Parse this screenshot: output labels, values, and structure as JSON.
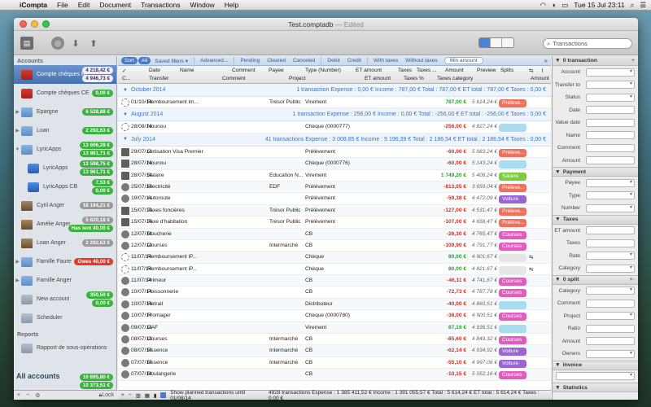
{
  "menubar": {
    "app": "iCompta",
    "items": [
      "File",
      "Edit",
      "Document",
      "Transactions",
      "Window",
      "Help"
    ],
    "clock": "Tue 15 Jul  23:11"
  },
  "window": {
    "title": "Test.comptadb",
    "edited": " — Edited"
  },
  "toolbar": {
    "search_placeholder": "Transactions"
  },
  "sidebar": {
    "header": "Accounts",
    "accounts": [
      {
        "name": "Compte chèques BP",
        "icon": "bank",
        "balances": [
          "4 218,42 €",
          "4 946,73 €"
        ],
        "colors": [
          "white",
          "white"
        ],
        "selected": true
      },
      {
        "name": "Compte chèques CE",
        "icon": "bank",
        "balances": [
          "0,00 €"
        ],
        "colors": [
          "green"
        ]
      },
      {
        "name": "Epargne",
        "icon": "folder",
        "disclosure": "▶",
        "balances": [
          "6 528,88 €"
        ],
        "colors": [
          "green"
        ]
      },
      {
        "name": "Loan",
        "icon": "folder",
        "disclosure": "▶",
        "balances": [
          "2 292,63 €"
        ],
        "colors": [
          "green"
        ]
      },
      {
        "name": "LyricApps",
        "icon": "folder",
        "disclosure": "▼",
        "balances": [
          "13 606,28 €",
          "13 961,71 €"
        ],
        "colors": [
          "green",
          "green"
        ]
      },
      {
        "name": "LyricApps",
        "icon": "app",
        "indent": true,
        "balances": [
          "13 598,75 €",
          "13 961,71 €"
        ],
        "colors": [
          "green",
          "green"
        ]
      },
      {
        "name": "LyricApps CB",
        "icon": "app",
        "indent": true,
        "balances": [
          "7,53 €",
          "0,00 €"
        ],
        "colors": [
          "green",
          "green"
        ]
      },
      {
        "name": "Cyril Anger",
        "icon": "face",
        "balances": [
          "18 194,21 €"
        ],
        "colors": [
          "gray"
        ]
      },
      {
        "name": "Amélie Anger",
        "icon": "face",
        "balances": [
          "5 820,18 €",
          "Has lent 40,00 €"
        ],
        "colors": [
          "gray",
          "green"
        ]
      },
      {
        "name": "Loan Anger",
        "icon": "face",
        "balances": [
          "2 292,63 €"
        ],
        "colors": [
          "gray"
        ]
      },
      {
        "name": "Famille Faure",
        "icon": "folder",
        "disclosure": "▶",
        "balances": [
          "Owes 40,00 €"
        ],
        "colors": [
          "red"
        ]
      },
      {
        "name": "Famille Anger",
        "icon": "folder",
        "disclosure": "▶",
        "balances": [],
        "colors": []
      },
      {
        "name": "New account",
        "icon": "plain",
        "balances": [
          "350,50 €",
          "0,00 €"
        ],
        "colors": [
          "green",
          "green"
        ]
      },
      {
        "name": "Scheduler",
        "icon": "plain",
        "balances": [],
        "colors": []
      }
    ],
    "reports_header": "Reports",
    "report_item": "Rapport de sous-opérations",
    "all_accounts": "All accounts",
    "all_balances": [
      "10 895,80 €",
      "10 373,61 €"
    ],
    "footer": {
      "plus": "+",
      "minus": "−",
      "gear": "⚙",
      "lock": "Lock"
    }
  },
  "filters": [
    "Sort",
    "All",
    "Saved filters ▾",
    "Advanced...",
    "Pending",
    "Cleared",
    "Canceled",
    "Debit",
    "Credit",
    "With taxes",
    "Without taxes"
  ],
  "min_amount_placeholder": "Min amount",
  "columns": {
    "row1": [
      "✓",
      "Date",
      "Name",
      "Comment",
      "Payee",
      "Type (Number)",
      "ET amount",
      "Taxes",
      "Taxes ...",
      "Amount",
      "Preview",
      "Splits"
    ],
    "row2": [
      "C...",
      "Transfer",
      "Comment",
      "Project",
      "ET amount",
      "Taxes %",
      "Taxes category",
      "Amount"
    ]
  },
  "groups": [
    {
      "month": "October 2014",
      "summary": "1 transaction   Expense : 0,00 €   Income : 787,00 €   Total : 787,00 €   ET total : 787,00 €   Taxes : 0,00 €",
      "rows": [
        {
          "s": "pending",
          "d": "01/10/14",
          "n": "Remboursement im...",
          "p": "Trésor Public",
          "t": "Virement",
          "a": "787,00 €",
          "ac": "pos",
          "b": "5 614,24 €",
          "c": "Prélève...",
          "cc": "c-prel"
        }
      ]
    },
    {
      "month": "August 2014",
      "summary": "1 transaction   Expense : 256,00 €   Income : 0,00 €   Total : -256,00 €   ET total : -256,00 €   Taxes : 0,00 €",
      "rows": [
        {
          "s": "pending",
          "d": "28/08/14",
          "n": "Nounou",
          "p": "",
          "t": "Chèque (0000777)",
          "a": "-256,00 €",
          "ac": "neg",
          "b": "4 827,24 €",
          "c": "",
          "cc": "c-light"
        }
      ]
    },
    {
      "month": "July 2014",
      "summary": "41 transactions   Expense : 3 008,85 €   Income : 5 196,39 €   Total : 2 186,54 €   ET total : 2 186,54 €   Taxes : 0,00 €",
      "rows": [
        {
          "s": "cal",
          "d": "29/07/14",
          "n": "Cotisation Visa Premier",
          "p": "",
          "t": "Prélèvement",
          "a": "-60,00 €",
          "ac": "neg",
          "b": "5 083,24 €",
          "c": "Prélève...",
          "cc": "c-prel"
        },
        {
          "s": "cal",
          "d": "28/07/14",
          "n": "Nounou",
          "p": "",
          "t": "Chèque (0000776)",
          "a": "-60,00 €",
          "ac": "neg",
          "b": "5 143,24 €",
          "c": "",
          "cc": "c-light"
        },
        {
          "s": "cal",
          "d": "28/07/14",
          "n": "Salaire",
          "p": "Education N...",
          "t": "Virement",
          "a": "1 749,20 €",
          "ac": "pos",
          "b": "5 408,24 €",
          "c": "Salaire",
          "cc": "c-sal"
        },
        {
          "s": "check",
          "d": "25/07/14",
          "n": "Electricité",
          "p": "EDF",
          "t": "Prélèvement",
          "a": "-813,05 €",
          "ac": "neg",
          "b": "3 659,04 €",
          "c": "Prélève...",
          "cc": "c-prel"
        },
        {
          "s": "check",
          "d": "19/07/14",
          "n": "Autoroute",
          "p": "",
          "t": "Prélèvement",
          "a": "-59,38 €",
          "ac": "neg",
          "b": "4 472,09 €",
          "c": "Voiture",
          "cc": "c-voit"
        },
        {
          "s": "cal",
          "d": "15/07/14",
          "n": "Taxes foncières",
          "p": "Trésor Public",
          "t": "Prélèvement",
          "a": "-127,00 €",
          "ac": "neg",
          "b": "4 531,47 €",
          "c": "Prélève...",
          "cc": "c-prel"
        },
        {
          "s": "cal",
          "d": "15/07/14",
          "n": "Taxe d'habitation",
          "p": "Trésor Public",
          "t": "Prélèvement",
          "a": "-107,00 €",
          "ac": "neg",
          "b": "4 658,47 €",
          "c": "Prélève...",
          "cc": "c-prel"
        },
        {
          "s": "check",
          "d": "12/07/14",
          "n": "Boucherie",
          "p": "",
          "t": "CB",
          "a": "-26,30 €",
          "ac": "neg",
          "b": "4 765,47 €",
          "c": "Courses",
          "cc": "c-cours"
        },
        {
          "s": "check",
          "d": "12/07/14",
          "n": "Courses",
          "p": "Intermarché",
          "t": "CB",
          "a": "-109,90 €",
          "ac": "neg",
          "b": "4 791,77 €",
          "c": "Courses",
          "cc": "c-cours"
        },
        {
          "s": "pending",
          "d": "11/07/14",
          "n": "Remboursement iP...",
          "p": "",
          "t": "Chèque",
          "a": "80,00 €",
          "ac": "pos",
          "b": "4 901,67 €",
          "c": "",
          "cc": "c-grey",
          "split": true
        },
        {
          "s": "pending",
          "d": "11/07/14",
          "n": "Remboursement iP...",
          "p": "",
          "t": "Chèque",
          "a": "80,00 €",
          "ac": "pos",
          "b": "4 821,67 €",
          "c": "",
          "cc": "c-grey",
          "split": true
        },
        {
          "s": "check",
          "d": "11/07/14",
          "n": "Primeur",
          "p": "",
          "t": "CB",
          "a": "-46,11 €",
          "ac": "neg",
          "b": "4 741,67 €",
          "c": "Courses",
          "cc": "c-cours"
        },
        {
          "s": "check",
          "d": "10/07/14",
          "n": "Poissonnerie",
          "p": "",
          "t": "CB",
          "a": "-72,73 €",
          "ac": "neg",
          "b": "4 787,78 €",
          "c": "Courses",
          "cc": "c-cours"
        },
        {
          "s": "check",
          "d": "10/07/14",
          "n": "Retrait",
          "p": "",
          "t": "Distributeur",
          "a": "-40,00 €",
          "ac": "neg",
          "b": "4 860,51 €",
          "c": "",
          "cc": "c-light"
        },
        {
          "s": "check",
          "d": "10/07/14",
          "n": "Fromager",
          "p": "",
          "t": "Chèque (0000780)",
          "a": "-36,00 €",
          "ac": "neg",
          "b": "4 900,51 €",
          "c": "Courses",
          "cc": "c-cours"
        },
        {
          "s": "check",
          "d": "09/07/14",
          "n": "CAF",
          "p": "",
          "t": "Virement",
          "a": "87,19 €",
          "ac": "pos",
          "b": "4 936,51 €",
          "c": "",
          "cc": "c-light"
        },
        {
          "s": "check",
          "d": "08/07/14",
          "n": "Courses",
          "p": "Intermarché",
          "t": "CB",
          "a": "-85,60 €",
          "ac": "neg",
          "b": "4 849,32 €",
          "c": "Courses",
          "cc": "c-cours"
        },
        {
          "s": "check",
          "d": "08/07/14",
          "n": "Essence",
          "p": "Intermarché",
          "t": "CB",
          "a": "-62,14 €",
          "ac": "neg",
          "b": "4 934,92 €",
          "c": "Voiture",
          "cc": "c-voit"
        },
        {
          "s": "check",
          "d": "07/07/14",
          "n": "Essence",
          "p": "Intermarché",
          "t": "CB",
          "a": "-55,10 €",
          "ac": "neg",
          "b": "4 997,06 €",
          "c": "Voiture",
          "cc": "c-voit"
        },
        {
          "s": "check",
          "d": "07/07/14",
          "n": "Boulangerie",
          "p": "",
          "t": "CB",
          "a": "-10,15 €",
          "ac": "neg",
          "b": "5 052,16 €",
          "c": "Courses",
          "cc": "c-cours"
        }
      ]
    }
  ],
  "status": {
    "show_planned": "Show planned transactions until 01/08/14",
    "summary": "4928 transactions   Expense : 1 385 411,52 €   Income : 1 391 055,57 €   Total : 5 614,24 €   ET total : 5 614,24 €   Taxes : 0,00 €"
  },
  "inspector": {
    "transaction_header": "0 transaction",
    "transaction_fields": [
      "Account",
      "Transfer to",
      "Status",
      "Date",
      "Value date",
      "Name",
      "Comment",
      "Amount"
    ],
    "payment_header": "Payment",
    "payment_fields": [
      "Payee",
      "Type",
      "Number"
    ],
    "taxes_header": "Taxes",
    "taxes_fields": [
      "ET amount",
      "Taxes",
      "Rate",
      "Category"
    ],
    "split_header": "0 split",
    "split_fields": [
      "Category",
      "Comment",
      "Project",
      "Ratio",
      "Amount",
      "Owners"
    ],
    "invoice_header": "Invoice",
    "stats_header": "Statistics"
  }
}
